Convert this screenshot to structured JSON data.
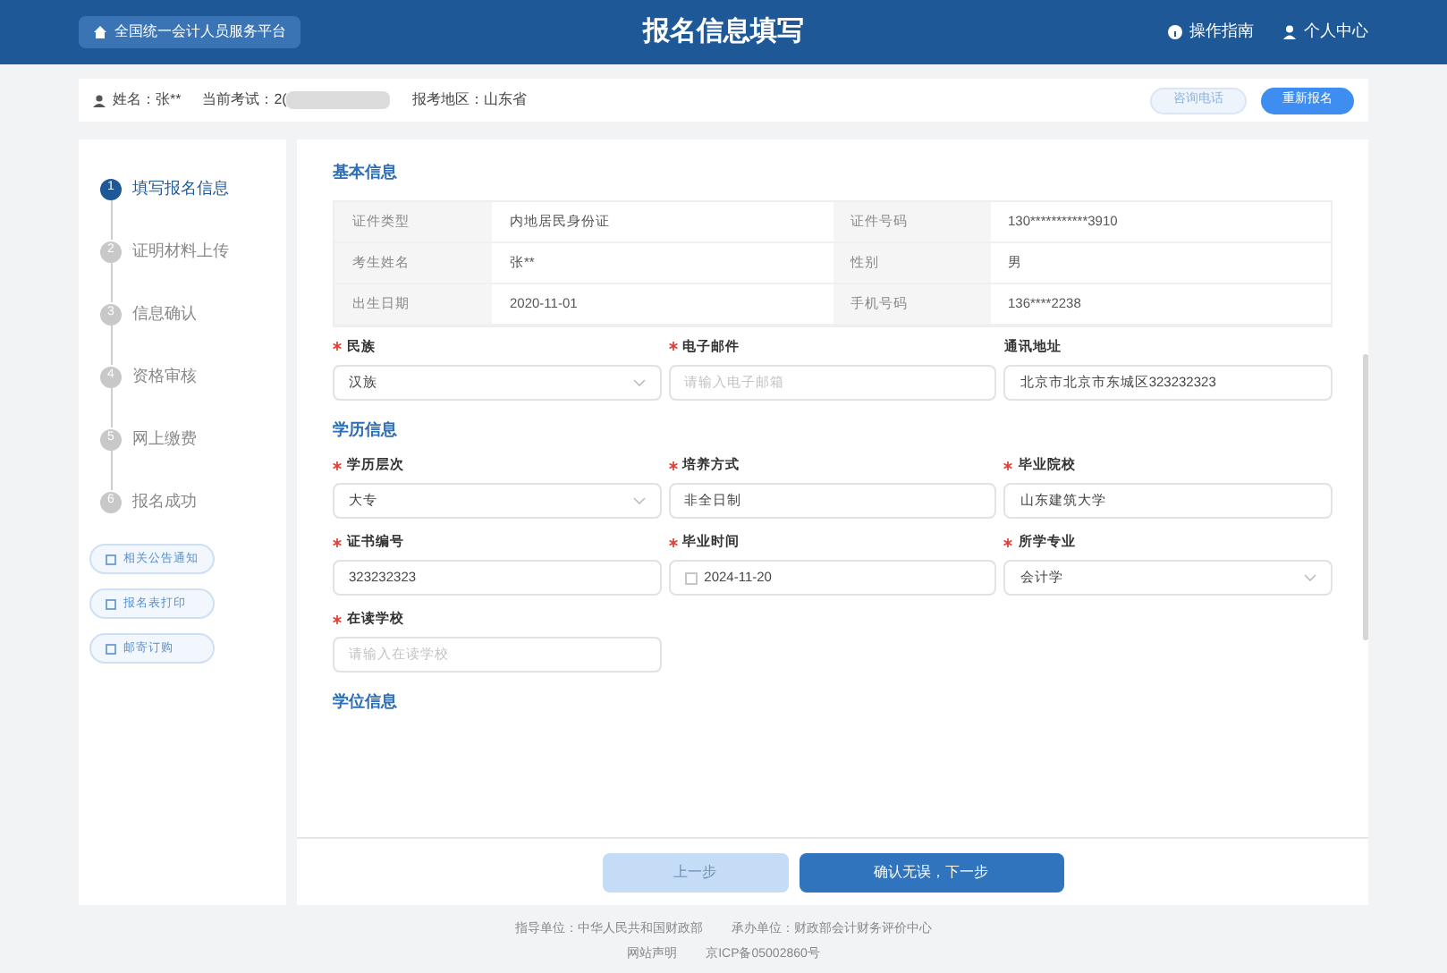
{
  "header": {
    "platform_link": "全国统一会计人员服务平台",
    "title": "报名信息填写",
    "links": [
      "操作指南",
      "个人中心"
    ]
  },
  "info_bar": {
    "name": "姓名：张**",
    "exam": "当前考试：2(",
    "region": "报考地区：山东省",
    "buttons": [
      "咨询电话",
      "重新报名"
    ]
  },
  "steps": [
    {
      "number": "1",
      "label": "填写报名信息",
      "selected": true
    },
    {
      "number": "2",
      "label": "证明材料上传",
      "selected": false
    },
    {
      "number": "3",
      "label": "信息确认",
      "selected": false
    },
    {
      "number": "4",
      "label": "资格审核",
      "selected": false
    },
    {
      "number": "5",
      "label": "网上缴费",
      "selected": false
    },
    {
      "number": "6",
      "label": "报名成功",
      "selected": false
    }
  ],
  "side_buttons": [
    "相关公告通知",
    "报名表打印",
    "邮寄订购"
  ],
  "basic_info": {
    "title": "基本信息",
    "rows": [
      [
        "证件类型",
        "内地居民身份证",
        "证件号码",
        "130***********3910"
      ],
      [
        "考生姓名",
        "张**",
        "性别",
        "男"
      ],
      [
        "出生日期",
        "2020-11-01",
        "手机号码",
        "136****2238"
      ]
    ]
  },
  "basic_fields": [
    {
      "label": "民族",
      "required": true,
      "kind": "select",
      "value": "汉族"
    },
    {
      "label": "电子邮件",
      "required": true,
      "kind": "input",
      "placeholder": "请输入电子邮箱"
    },
    {
      "label": "通讯地址",
      "required": false,
      "kind": "input",
      "value": "北京市北京市东城区323232323"
    }
  ],
  "education": {
    "title": "学历信息",
    "fields": [
      {
        "label": "学历层次",
        "required": true,
        "kind": "select",
        "value": "大专"
      },
      {
        "label": "培养方式",
        "required": true,
        "kind": "input",
        "value": "非全日制"
      },
      {
        "label": "毕业院校",
        "required": true,
        "kind": "input",
        "value": "山东建筑大学"
      },
      {
        "label": "证书编号",
        "required": true,
        "kind": "input",
        "value": "323232323"
      },
      {
        "label": "毕业时间",
        "required": true,
        "kind": "date",
        "value": "2024-11-20"
      },
      {
        "label": "所学专业",
        "required": true,
        "kind": "select",
        "value": "会计学"
      },
      {
        "label": "在读学校",
        "required": true,
        "kind": "input",
        "placeholder": "请输入在读学校"
      }
    ]
  },
  "degree": {
    "title": "学位信息"
  },
  "actions": [
    "上一步",
    "确认无误，下一步"
  ],
  "footer": {
    "line_1": [
      "指导单位：中华人民共和国财政部",
      "承办单位：财政部会计财务评价中心"
    ],
    "line_2": [
      "网站声明",
      "京ICP备05002860号"
    ]
  }
}
